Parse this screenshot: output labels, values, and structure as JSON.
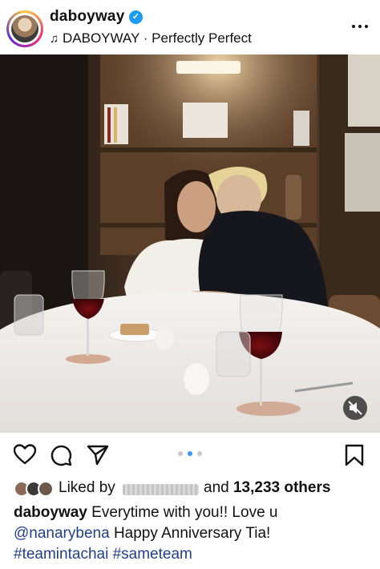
{
  "post": {
    "username": "daboyway",
    "audio_label": "DABOYWAY · Perfectly Perfect"
  },
  "icons": {
    "verified": "verified-badge-icon",
    "music": "music-note-icon",
    "more": "more-options-icon",
    "like": "heart-icon",
    "comment": "comment-icon",
    "share": "send-icon",
    "save": "bookmark-icon",
    "mute": "mute-icon"
  },
  "carousel": {
    "count": 3,
    "active_index": 1
  },
  "likes": {
    "prefix": "Liked by",
    "suffix_text": "and ",
    "count_text": "13,233 others"
  },
  "caption": {
    "username": "daboyway",
    "line1_text": "Everytime with you!! Love u",
    "mention": "@nanarybena",
    "line2_text": "Happy Anniversary Tia!",
    "hashtags": "#teamintachai #sameteam"
  },
  "colors": {
    "verified_blue": "#1d9bf0",
    "link_blue": "#1f3f8a",
    "active_dot": "#3897f0"
  }
}
